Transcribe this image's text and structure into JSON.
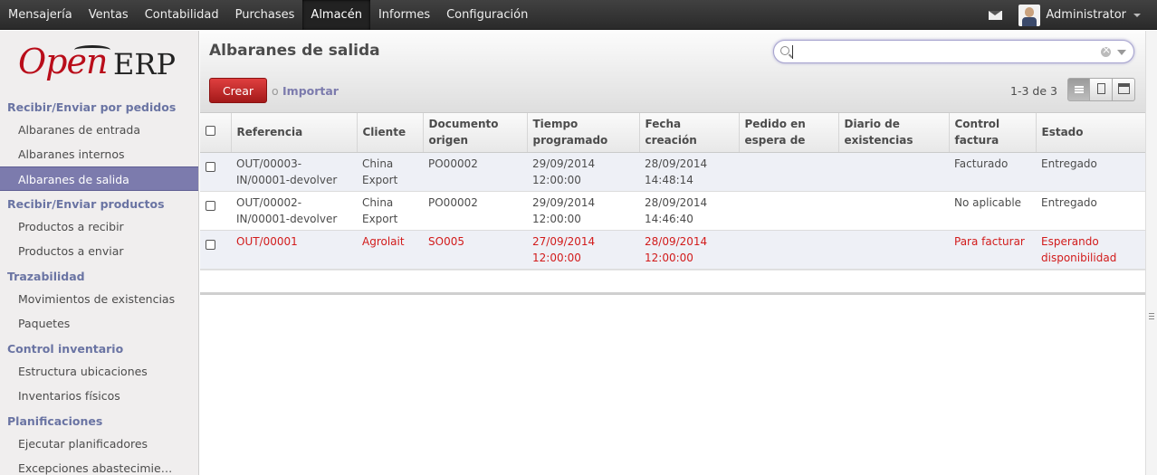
{
  "topmenu": [
    "Mensajería",
    "Ventas",
    "Contabilidad",
    "Purchases",
    "Almacén",
    "Informes",
    "Configuración"
  ],
  "active_menu": "Almacén",
  "user": {
    "name": "Administrator"
  },
  "logo": {
    "open": "Open",
    "erp": "ERP"
  },
  "sidebar": {
    "sections": [
      {
        "title": "Recibir/Enviar por pedidos",
        "items": [
          "Albaranes de entrada",
          "Albaranes internos",
          "Albaranes de salida"
        ]
      },
      {
        "title": "Recibir/Enviar productos",
        "items": [
          "Productos a recibir",
          "Productos a enviar"
        ]
      },
      {
        "title": "Trazabilidad",
        "items": [
          "Movimientos de existencias",
          "Paquetes"
        ]
      },
      {
        "title": "Control inventario",
        "items": [
          "Estructura ubicaciones",
          "Inventarios físicos"
        ]
      },
      {
        "title": "Planificaciones",
        "items": [
          "Ejecutar planificadores",
          "Excepciones abastecimie…"
        ]
      }
    ],
    "active_item": "Albaranes de salida"
  },
  "page": {
    "title": "Albaranes de salida",
    "create_label": "Crear",
    "or_label": "o",
    "import_label": "Importar",
    "pager": "1-3 de 3",
    "search_value": ""
  },
  "table": {
    "columns": [
      "Referencia",
      "Cliente",
      "Documento origen",
      "Tiempo programado",
      "Fecha creación",
      "Pedido en espera de",
      "Diario de existencias",
      "Control factura",
      "Estado"
    ],
    "rows": [
      {
        "reference": "OUT/00003-IN/00001-devolver",
        "client": "China Export",
        "origin": "PO00002",
        "scheduled": "29/09/2014 12:00:00",
        "created": "28/09/2014 14:48:14",
        "backorder": "",
        "journal": "",
        "invoice_control": "Facturado",
        "state": "Entregado",
        "highlight": false
      },
      {
        "reference": "OUT/00002-IN/00001-devolver",
        "client": "China Export",
        "origin": "PO00002",
        "scheduled": "29/09/2014 12:00:00",
        "created": "28/09/2014 14:46:40",
        "backorder": "",
        "journal": "",
        "invoice_control": "No aplicable",
        "state": "Entregado",
        "highlight": false
      },
      {
        "reference": "OUT/00001",
        "client": "Agrolait",
        "origin": "SO005",
        "scheduled": "27/09/2014 12:00:00",
        "created": "28/09/2014 12:00:00",
        "backorder": "",
        "journal": "",
        "invoice_control": "Para facturar",
        "state": "Esperando disponibilidad",
        "highlight": true
      }
    ]
  },
  "colors": {
    "accent": "#7c7bad",
    "create": "#c82a2a",
    "warning_row": "#d21b1b",
    "topbar": "#353535"
  }
}
